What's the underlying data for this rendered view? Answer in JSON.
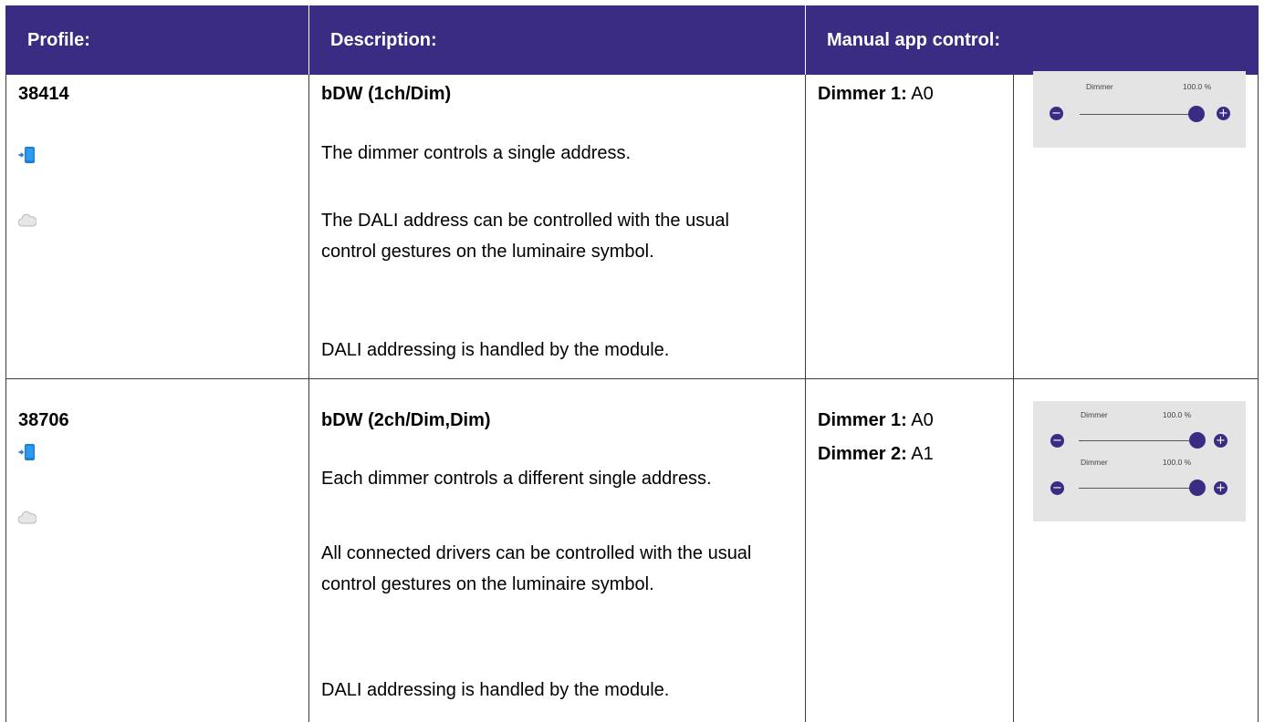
{
  "header": {
    "col_profile": "Profile:",
    "col_description": "Description:",
    "col_manual": "Manual app control:"
  },
  "colors": {
    "header_bg": "#3a2c83",
    "accent": "#3a2c83",
    "panel_bg": "#e4e4e4"
  },
  "rows": [
    {
      "profile": "38414",
      "icons": [
        "phone-push-icon",
        "cloud-icon"
      ],
      "title": "bDW (1ch/Dim)",
      "paragraphs": [
        "The dimmer controls a single address.",
        "The DALI address can be controlled with the usual control gestures on the luminaire symbol.",
        "DALI addressing is handled by the module."
      ],
      "dimmers": [
        {
          "label": "Dimmer 1:",
          "value": "A0"
        }
      ],
      "controls": [
        {
          "name": "Dimmer",
          "value": "100.0 %",
          "level": 1.0
        }
      ]
    },
    {
      "profile": "38706",
      "icons": [
        "phone-push-icon",
        "cloud-icon"
      ],
      "title": "bDW (2ch/Dim,Dim)",
      "paragraphs": [
        "Each dimmer controls a different single address.",
        "All connected drivers can be controlled with the usual control gestures on the luminaire symbol.",
        "DALI addressing is handled by the module."
      ],
      "dimmers": [
        {
          "label": "Dimmer 1:",
          "value": "A0"
        },
        {
          "label": "Dimmer 2:",
          "value": "A1"
        }
      ],
      "controls": [
        {
          "name": "Dimmer",
          "value": "100.0 %",
          "level": 1.0
        },
        {
          "name": "Dimmer",
          "value": "100.0 %",
          "level": 1.0
        }
      ]
    }
  ]
}
